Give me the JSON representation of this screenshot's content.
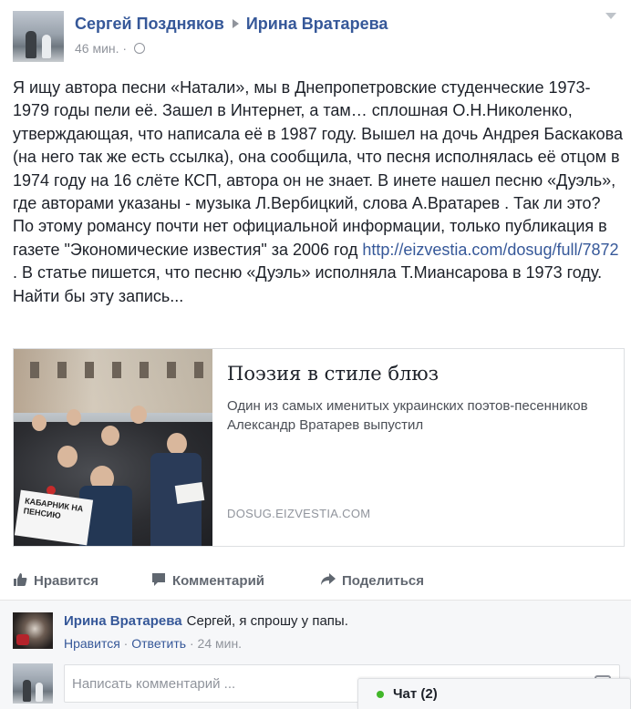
{
  "post": {
    "author": "Сергей Поздняков",
    "target": "Ирина Вратарева",
    "time": "46 мин.",
    "time_sep": "·",
    "text": {
      "line1": "Я ищу автора песни «Натали», мы в Днепропетровские студенческие 1973-1979 годы пели её. Зашел в Интернет, а там… сплошная О.Н.Николенко, утверждающая, что написала её в 1987 году. Вышел на дочь Андрея Баскакова (на него так же есть ссылка), она сообщила, что песня исполнялась её отцом в 1974 году на 16 слёте КСП, автора он не знает. В инете нашел песню «Дуэль», где авторами указаны - музыка Л.Вербицкий, слова А.Вратарев . Так ли это?",
      "line2_before": "По этому романсу почти нет официальной информации, только публикация в газете \"Экономические известия\" за 2006 год ",
      "link": "http://eizvestia.com/dosug/full/7872",
      "line2_after": " . В статье пишется, что песню «Дуэль» исполняла Т.Миансарова в 1973 году. Найти бы эту запись..."
    },
    "card": {
      "title": "Поэзия в стиле блюз",
      "description": "Один из самых именитых украинских поэтов-песенников Александр Вратарев выпустил",
      "domain": "DOSUG.EIZVESTIA.COM",
      "image_sign_text": "КАБАРНИК НА ПЕНСИЮ"
    },
    "actions": {
      "like": "Нравится",
      "comment": "Комментарий",
      "share": "Поделиться"
    }
  },
  "comment": {
    "author": "Ирина Вратарева",
    "text": "Сергей, я спрошу у папы.",
    "like": "Нравится",
    "reply": "Ответить",
    "time": "24 мин.",
    "sep": "·"
  },
  "composer": {
    "placeholder": "Написать комментарий ..."
  },
  "chat": {
    "label": "Чат (2)",
    "status_color": "#42b72a"
  },
  "colors": {
    "link": "#365899",
    "meta": "#90949c",
    "text": "#1d2129"
  }
}
